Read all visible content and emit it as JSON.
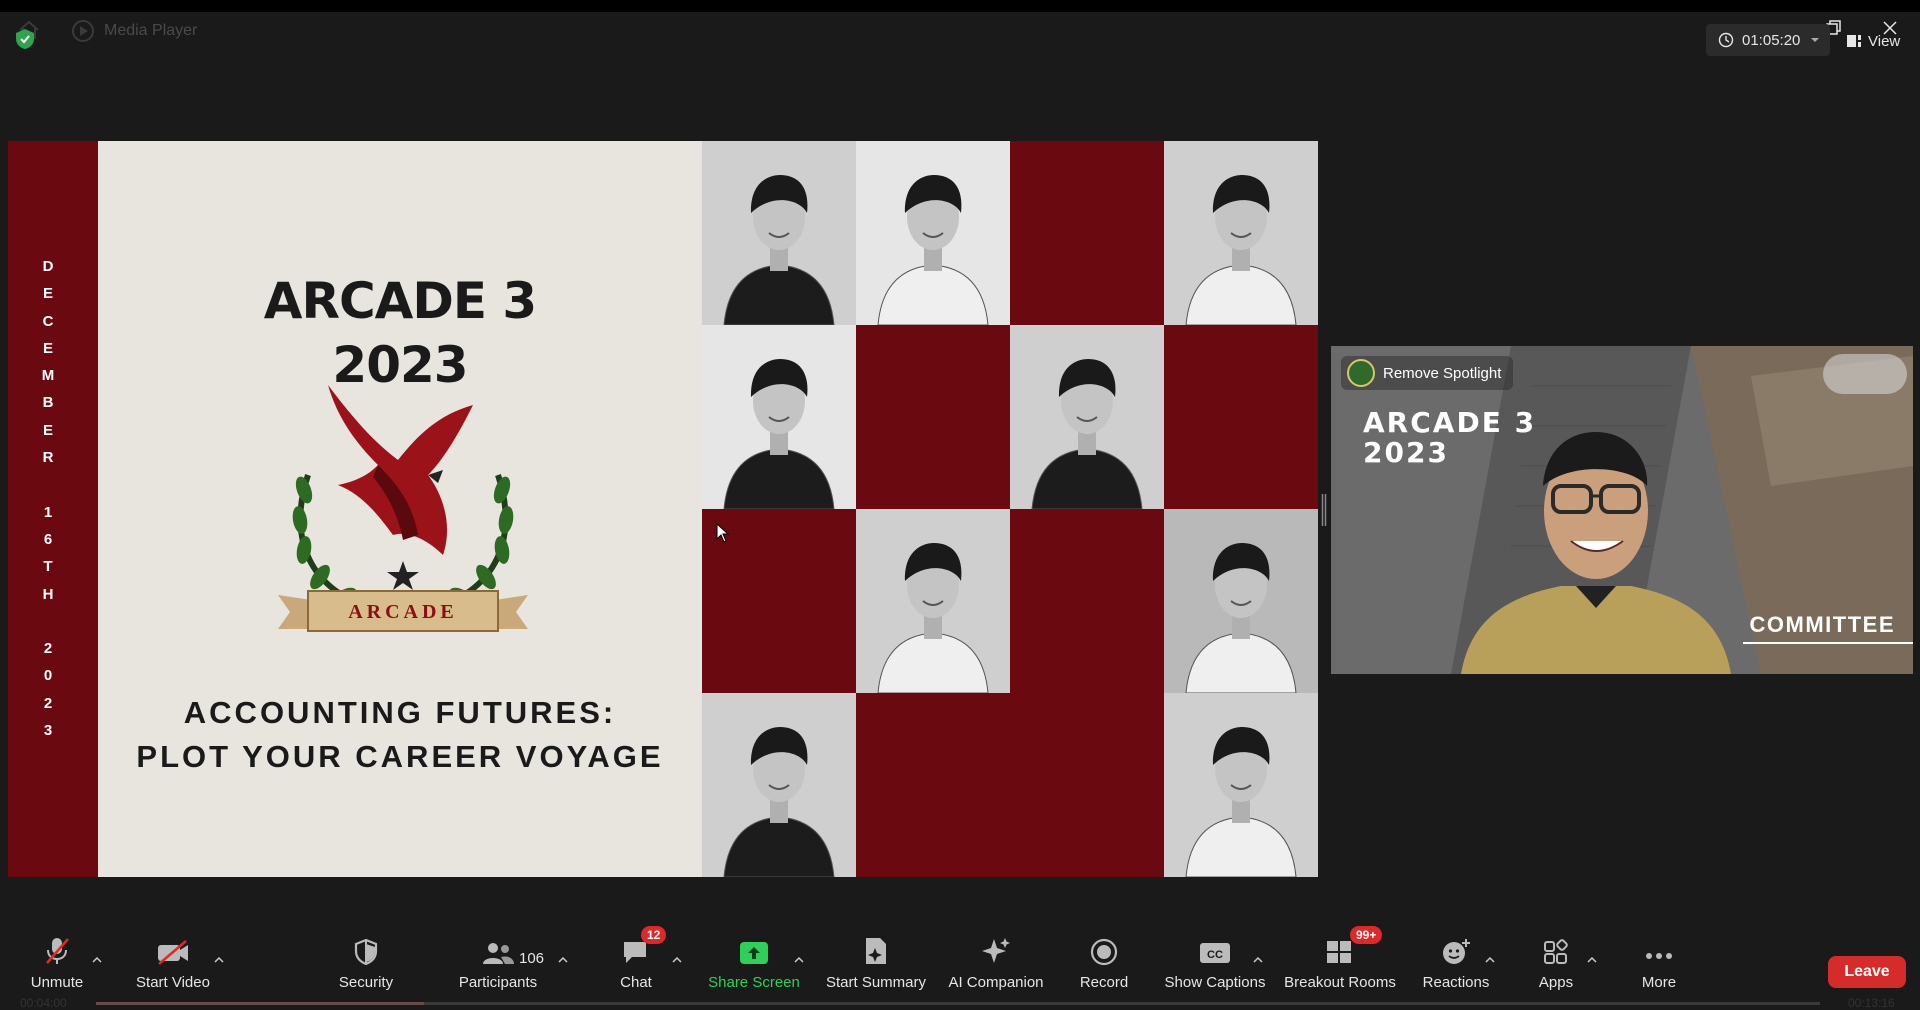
{
  "window": {
    "title": "Media Player"
  },
  "header": {
    "timer": "01:05:20",
    "view_label": "View"
  },
  "slide": {
    "rail_letters": [
      "D",
      "E",
      "C",
      "E",
      "M",
      "B",
      "E",
      "R",
      "",
      "1",
      "6",
      "T",
      "H",
      "",
      "2",
      "0",
      "2",
      "3"
    ],
    "title_line1": "ARCADE 3",
    "title_line2": "2023",
    "logo_ribbon": "ARCADE",
    "subtitle_line1": "ACCOUNTING FUTURES:",
    "subtitle_line2": "PLOT YOUR CAREER VOYAGE",
    "grid_cells": [
      "photo",
      "photo",
      "red",
      "photo",
      "photo",
      "red",
      "photo",
      "red",
      "red",
      "photo",
      "red",
      "photo",
      "photo",
      "red",
      "red",
      "photo"
    ]
  },
  "speaker": {
    "spotlight_label": "Remove Spotlight",
    "title_line1": "ARCADE 3",
    "title_line2": "2023",
    "role": "COMMITTEE"
  },
  "toolbar": {
    "unmute": "Unmute",
    "start_video": "Start Video",
    "security": "Security",
    "participants": "Participants",
    "participants_count": "106",
    "chat": "Chat",
    "chat_badge": "12",
    "share_screen": "Share Screen",
    "start_summary": "Start Summary",
    "ai_companion": "AI Companion",
    "record": "Record",
    "show_captions": "Show Captions",
    "breakout_rooms": "Breakout Rooms",
    "breakout_badge": "99+",
    "reactions": "Reactions",
    "apps": "Apps",
    "more": "More",
    "leave": "Leave"
  },
  "playback": {
    "elapsed": "00:04:00",
    "total": "00:13:16",
    "progress": 0.19
  },
  "colors": {
    "maroon": "#6a0a10",
    "share_green": "#2fd05a",
    "leave_red": "#d62b2b",
    "poster_bg": "#e8e4de"
  }
}
